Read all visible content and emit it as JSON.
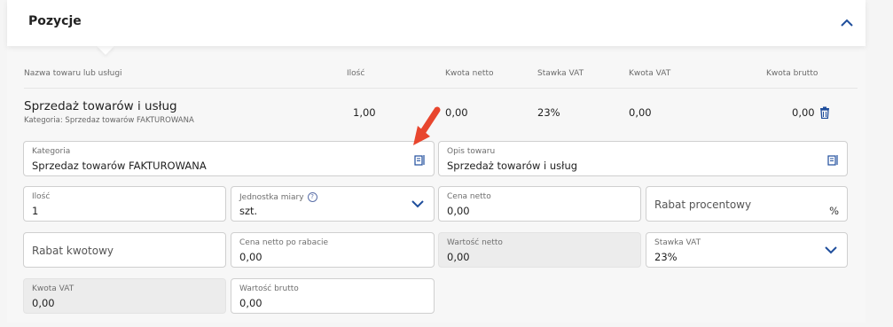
{
  "section": {
    "title": "Pozycje"
  },
  "columns": {
    "name": "Nazwa towaru lub usługi",
    "qty": "Ilość",
    "net": "Kwota netto",
    "vat_rate": "Stawka VAT",
    "vat_amount": "Kwota VAT",
    "gross": "Kwota brutto"
  },
  "row": {
    "name": "Sprzedaż towarów i usług",
    "category": "Kategoria: Sprzedaz towarów FAKTUROWANA",
    "qty": "1,00",
    "net": "0,00",
    "vat_rate": "23%",
    "vat_amount": "0,00",
    "gross": "0,00"
  },
  "form": {
    "kategoria": {
      "label": "Kategoria",
      "value": "Sprzedaz towarów FAKTUROWANA"
    },
    "opis": {
      "label": "Opis towaru",
      "value": "Sprzedaż towarów i usług"
    },
    "ilosc": {
      "label": "Ilość",
      "value": "1"
    },
    "jednostka": {
      "label": "Jednostka miary",
      "value": "szt.",
      "help": "?"
    },
    "cena_netto": {
      "label": "Cena netto",
      "value": "0,00"
    },
    "rabat_proc": {
      "placeholder": "Rabat procentowy",
      "suffix": "%"
    },
    "rabat_kw": {
      "placeholder": "Rabat kwotowy"
    },
    "cena_po_rabacie": {
      "label": "Cena netto po rabacie",
      "value": "0,00"
    },
    "wartosc_netto": {
      "label": "Wartość netto",
      "value": "0,00"
    },
    "stawka_vat": {
      "label": "Stawka VAT",
      "value": "23%"
    },
    "kwota_vat": {
      "label": "Kwota VAT",
      "value": "0,00"
    },
    "wartosc_brutto": {
      "label": "Wartość brutto",
      "value": "0,00"
    }
  },
  "colors": {
    "accent": "#1f4e9c",
    "arrow": "#e8462e"
  }
}
